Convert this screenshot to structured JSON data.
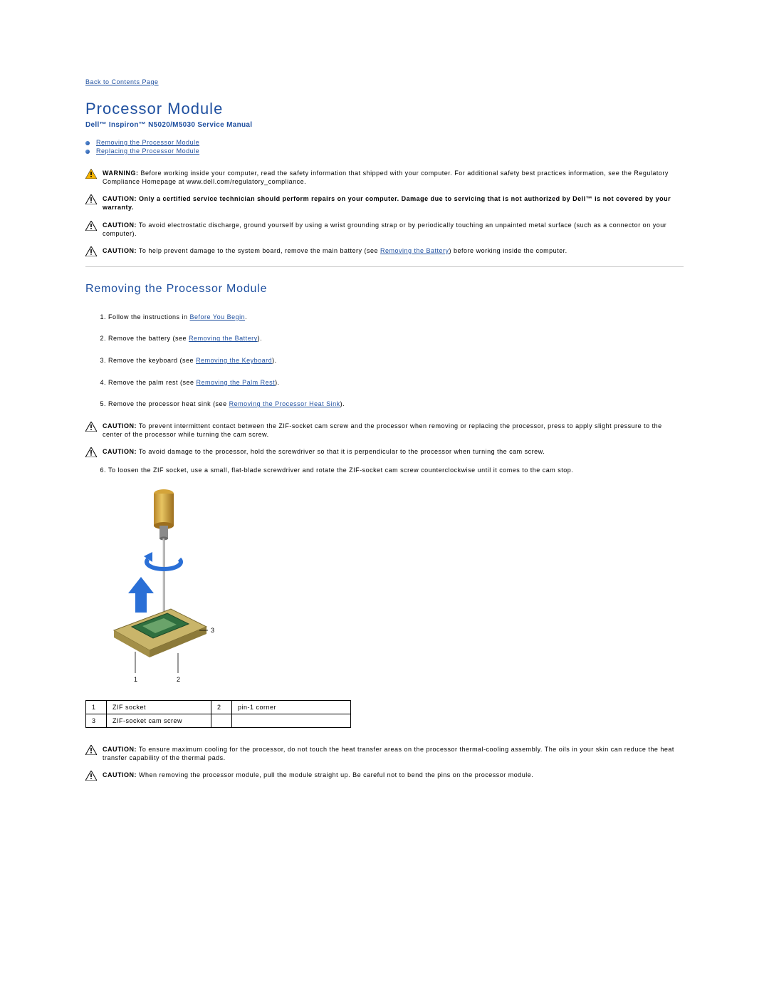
{
  "navigation": {
    "back_link": "Back to Contents Page"
  },
  "header": {
    "title": "Processor Module",
    "subtitle": "Dell™ Inspiron™ N5020/M5030 Service Manual"
  },
  "toc": {
    "items": [
      "Removing the Processor Module",
      "Replacing the Processor Module"
    ]
  },
  "notices": {
    "warning": {
      "label": "WARNING:",
      "text": " Before working inside your computer, read the safety information that shipped with your computer. For additional safety best practices information, see the Regulatory Compliance Homepage at www.dell.com/regulatory_compliance."
    },
    "caution1": {
      "label": "CAUTION:",
      "bold": " Only a certified service technician should perform repairs on your computer. Damage due to servicing that is not authorized by Dell™ is not covered by your warranty."
    },
    "caution2": {
      "label": "CAUTION:",
      "text": " To avoid electrostatic discharge, ground yourself by using a wrist grounding strap or by periodically touching an unpainted metal surface (such as a connector on your computer)."
    },
    "caution3": {
      "label": "CAUTION:",
      "text_before": " To help prevent damage to the system board, remove the main battery (see ",
      "link": "Removing the Battery",
      "text_after": ") before working inside the computer."
    },
    "caution4": {
      "label": "CAUTION:",
      "text": " To prevent intermittent contact between the ZIF-socket cam screw and the processor when removing or replacing the processor, press to apply slight pressure to the center of the processor while turning the cam screw."
    },
    "caution5": {
      "label": "CAUTION:",
      "text": " To avoid damage to the processor, hold the screwdriver so that it is perpendicular to the processor when turning the cam screw."
    },
    "caution6": {
      "label": "CAUTION:",
      "text": " To ensure maximum cooling for the processor, do not touch the heat transfer areas on the processor thermal-cooling assembly. The oils in your skin can reduce the heat transfer capability of the thermal pads."
    },
    "caution7": {
      "label": "CAUTION:",
      "text": " When removing the processor module, pull the module straight up. Be careful not to bend the pins on the processor module."
    }
  },
  "section": {
    "heading": "Removing the Processor Module"
  },
  "steps": {
    "s1_before": "Follow the instructions in ",
    "s1_link": "Before You Begin",
    "s1_after": ".",
    "s2_before": "Remove the battery (see ",
    "s2_link": "Removing the Battery",
    "s2_after": ").",
    "s3_before": "Remove the keyboard (see ",
    "s3_link": "Removing the Keyboard",
    "s3_after": ").",
    "s4_before": "Remove the palm rest (see ",
    "s4_link": "Removing the Palm Rest",
    "s4_after": ").",
    "s5_before": "Remove the processor heat sink (see ",
    "s5_link": "Removing the Processor Heat Sink",
    "s5_after": ").",
    "s6": "To loosen the ZIF socket, use a small, flat-blade screwdriver and rotate the ZIF-socket cam screw counterclockwise until it comes to the cam stop."
  },
  "callouts": {
    "r1c1": "1",
    "r1c2": "ZIF socket",
    "r1c3": "2",
    "r1c4": "pin-1 corner",
    "r2c1": "3",
    "r2c2": "ZIF-socket cam screw"
  },
  "figure": {
    "label1": "1",
    "label2": "2",
    "label3": "3"
  }
}
